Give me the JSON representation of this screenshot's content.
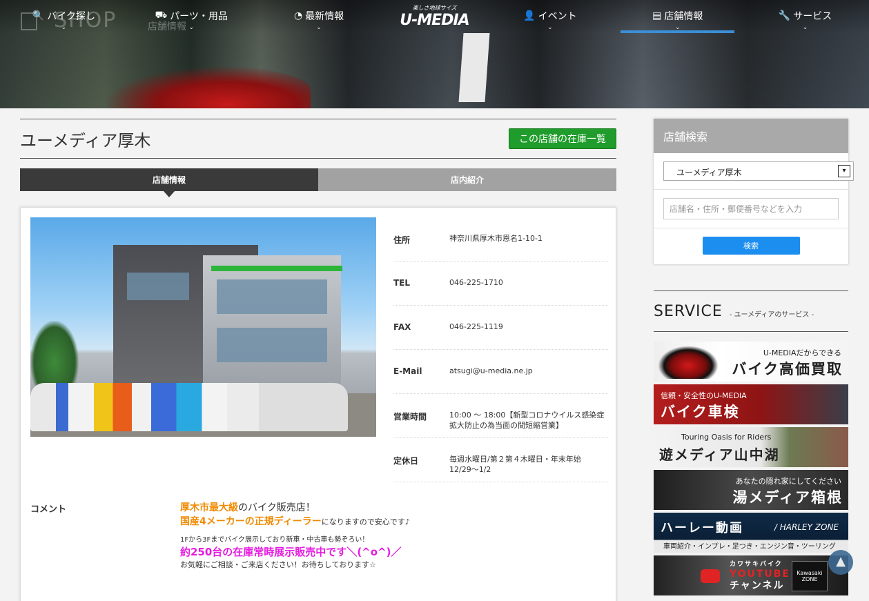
{
  "hero": {
    "bg_word": "SHOP",
    "bg_sub": "店舗情報"
  },
  "nav": {
    "items": [
      {
        "label": "バイク探し",
        "icon": "search-icon"
      },
      {
        "label": "パーツ・用品",
        "icon": "motorcycle-icon"
      },
      {
        "label": "最新情報",
        "icon": "rss-icon"
      },
      {
        "label": "イベント",
        "icon": "person-icon"
      },
      {
        "label": "店舗情報",
        "icon": "building-icon"
      },
      {
        "label": "サービス",
        "icon": "wrench-icon"
      }
    ],
    "logo_tagline": "楽しさ地球サイズ",
    "logo_brand": "U-MEDIA",
    "active_color": "#3b8fd8"
  },
  "page": {
    "title": "ユーメディア厚木",
    "stock_button": "この店舗の在庫一覧",
    "tabs": [
      {
        "label": "店舗情報"
      },
      {
        "label": "店内紹介"
      }
    ]
  },
  "shop": {
    "rows": [
      {
        "key": "住所",
        "value": "神奈川県厚木市恩名1-10-1"
      },
      {
        "key": "TEL",
        "value": "046-225-1710"
      },
      {
        "key": "FAX",
        "value": "046-225-1119"
      },
      {
        "key": "E-Mail",
        "value": "atsugi@u-media.ne.jp"
      },
      {
        "key": "営業時間",
        "value": "10:00 〜 18:00【新型コロナウイルス感染症拡大防止の為当面の間短縮営業】"
      },
      {
        "key": "定休日",
        "value": "毎週水曜日/第２第４木曜日・年末年始12/29〜1/2"
      }
    ],
    "comment_label": "コメント",
    "comment": {
      "l1_hl": "厚木市最大級",
      "l1_rest": "のバイク販売店！",
      "l2_hl": "国産4メーカーの正規ディーラー",
      "l2_rest": "になりますので安心です♪",
      "l3": "1Fから3Fまでバイク展示しており新車・中古車も勢ぞろい！",
      "l4_hl": "約250台の在庫常時展示販売中です＼(^o^)／",
      "l5": "お気軽にご相談・ご来店ください！お待ちしております☆"
    }
  },
  "sidebar": {
    "search_title": "店舗検索",
    "selected_shop": "ユーメディア厚木",
    "search_placeholder": "店舗名・住所・郵便番号などを入力",
    "search_button": "検索",
    "service_title": "SERVICE",
    "service_sub": "- ユーメディアのサービス -",
    "banners": {
      "kaitori_1": "U-MEDIAだからできる",
      "kaitori_2": "バイク高価買取",
      "shaken_1": "信頼・安全性のU-MEDIA",
      "shaken_2": "バイク車検",
      "yamanaka_1": "Touring Oasis for Riders",
      "yamanaka_2": "遊メディア山中湖",
      "hakone_1": "あなたの隠れ家にしてください",
      "hakone_2": "湯メディア箱根",
      "harley_1": "ハーレー動画",
      "harley_2": "/ HARLEY ZONE",
      "harley_3": "車両紹介・インプレ・足つき・エンジン音・ツーリング",
      "kawa_1": "カワサキバイク",
      "kawa_2": "YOUTUBE",
      "kawa_3": "チャンネル",
      "kawa_zone": "Kawasaki ZONE"
    }
  },
  "totop": "▲"
}
